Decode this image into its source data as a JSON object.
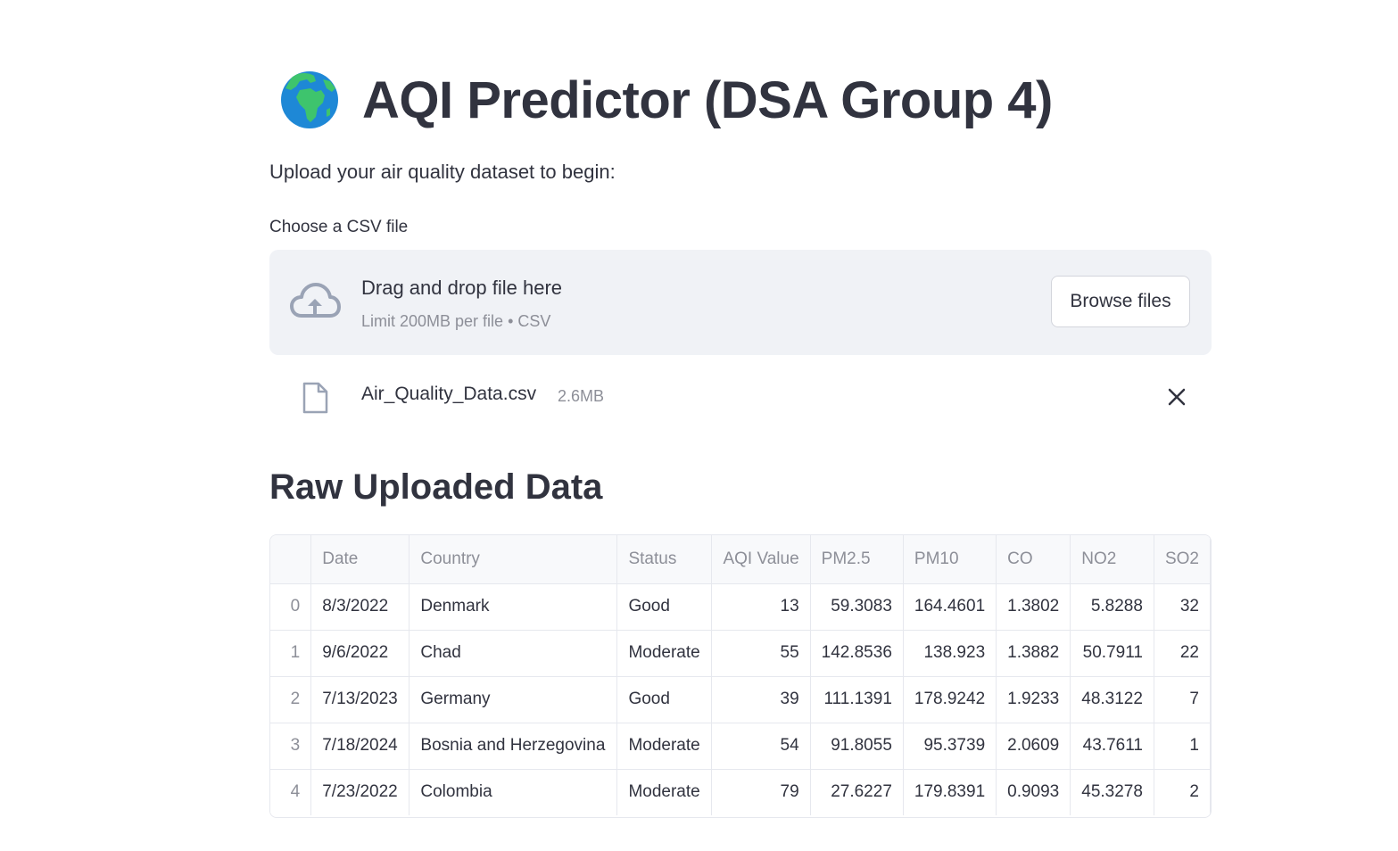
{
  "header": {
    "title": "AQI Predictor (DSA Group 4)",
    "subtitle": "Upload your air quality dataset to begin:"
  },
  "uploader": {
    "label": "Choose a CSV file",
    "drag_text": "Drag and drop file here",
    "limit_text": "Limit 200MB per file • CSV",
    "browse_label": "Browse files",
    "file_name": "Air_Quality_Data.csv",
    "file_size": "2.6MB"
  },
  "section": {
    "title": "Raw Uploaded Data"
  },
  "table": {
    "columns": [
      "",
      "Date",
      "Country",
      "Status",
      "AQI Value",
      "PM2.5",
      "PM10",
      "CO",
      "NO2",
      "SO2"
    ],
    "rows": [
      [
        "0",
        "8/3/2022",
        "Denmark",
        "Good",
        "13",
        "59.3083",
        "164.4601",
        "1.3802",
        "5.8288",
        "32"
      ],
      [
        "1",
        "9/6/2022",
        "Chad",
        "Moderate",
        "55",
        "142.8536",
        "138.923",
        "1.3882",
        "50.7911",
        "22"
      ],
      [
        "2",
        "7/13/2023",
        "Germany",
        "Good",
        "39",
        "111.1391",
        "178.9242",
        "1.9233",
        "48.3122",
        "7"
      ],
      [
        "3",
        "7/18/2024",
        "Bosnia and Herzegovina",
        "Moderate",
        "54",
        "91.8055",
        "95.3739",
        "2.0609",
        "43.7611",
        "1"
      ],
      [
        "4",
        "7/23/2022",
        "Colombia",
        "Moderate",
        "79",
        "27.6227",
        "179.8391",
        "0.9093",
        "45.3278",
        "2"
      ]
    ]
  },
  "icons": {
    "title_icon": "globe-africa-icon",
    "upload_icon": "cloud-upload-icon",
    "file_icon": "file-icon",
    "remove_icon": "close-icon"
  },
  "colors": {
    "text": "#31333f",
    "muted": "#8d8f98",
    "dropzone_bg": "#f0f2f6",
    "border": "#e6e8ee"
  }
}
